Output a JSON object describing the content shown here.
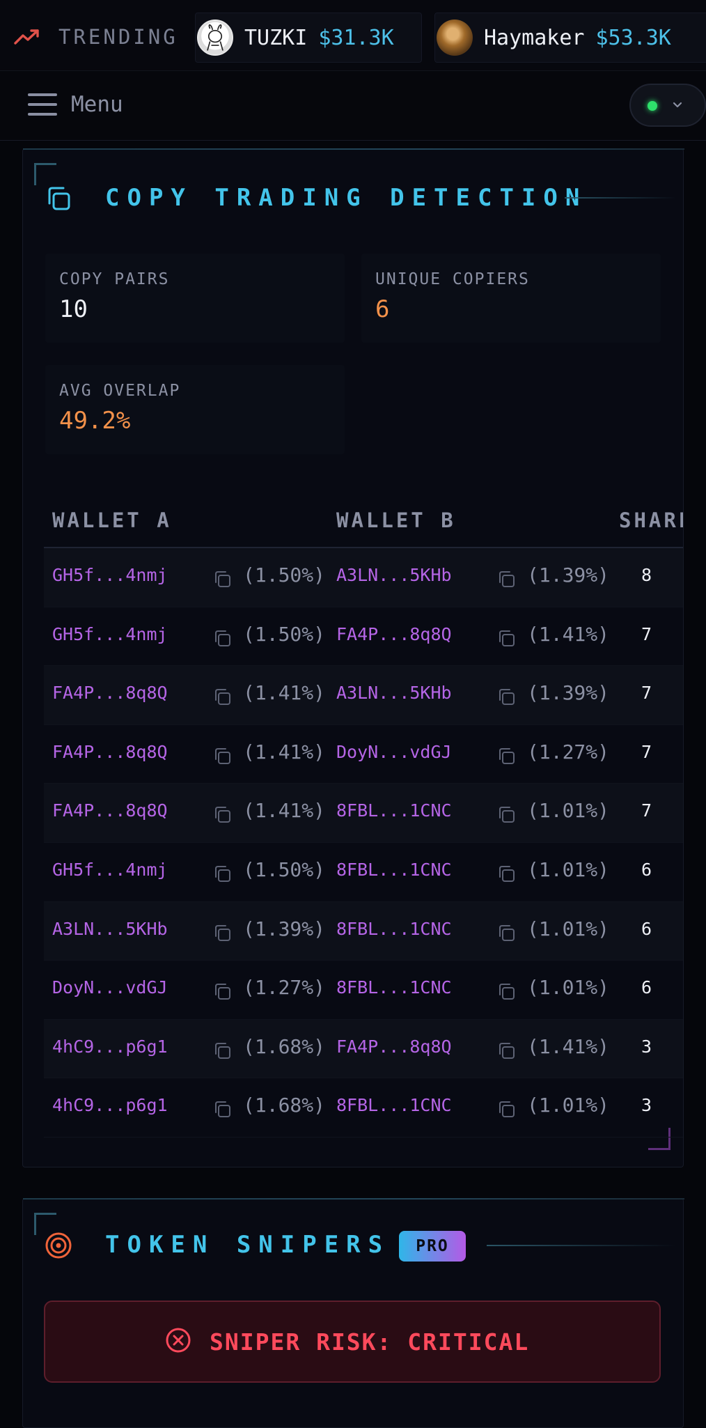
{
  "trending": {
    "label": "TRENDING",
    "tokens": [
      {
        "name": "TUZKI",
        "price": "$31.3K"
      },
      {
        "name": "Haymaker",
        "price": "$53.3K"
      }
    ]
  },
  "menu": {
    "label": "Menu",
    "status_color": "#2ee06b"
  },
  "copy_trading": {
    "title": "COPY TRADING DETECTION",
    "stats": [
      {
        "label": "COPY PAIRS",
        "value": "10"
      },
      {
        "label": "UNIQUE COPIERS",
        "value": "6"
      },
      {
        "label": "AVG OVERLAP",
        "value": "49.2%"
      }
    ],
    "table": {
      "headers": [
        "WALLET A",
        "WALLET B",
        "SHARED"
      ],
      "rows": [
        {
          "a": "GH5f...4nmj",
          "a_pct": "(1.50%)",
          "b": "A3LN...5KHb",
          "b_pct": "(1.39%)",
          "shared": "8"
        },
        {
          "a": "GH5f...4nmj",
          "a_pct": "(1.50%)",
          "b": "FA4P...8q8Q",
          "b_pct": "(1.41%)",
          "shared": "7"
        },
        {
          "a": "FA4P...8q8Q",
          "a_pct": "(1.41%)",
          "b": "A3LN...5KHb",
          "b_pct": "(1.39%)",
          "shared": "7"
        },
        {
          "a": "FA4P...8q8Q",
          "a_pct": "(1.41%)",
          "b": "DoyN...vdGJ",
          "b_pct": "(1.27%)",
          "shared": "7"
        },
        {
          "a": "FA4P...8q8Q",
          "a_pct": "(1.41%)",
          "b": "8FBL...1CNC",
          "b_pct": "(1.01%)",
          "shared": "7"
        },
        {
          "a": "GH5f...4nmj",
          "a_pct": "(1.50%)",
          "b": "8FBL...1CNC",
          "b_pct": "(1.01%)",
          "shared": "6"
        },
        {
          "a": "A3LN...5KHb",
          "a_pct": "(1.39%)",
          "b": "8FBL...1CNC",
          "b_pct": "(1.01%)",
          "shared": "6"
        },
        {
          "a": "DoyN...vdGJ",
          "a_pct": "(1.27%)",
          "b": "8FBL...1CNC",
          "b_pct": "(1.01%)",
          "shared": "6"
        },
        {
          "a": "4hC9...p6g1",
          "a_pct": "(1.68%)",
          "b": "FA4P...8q8Q",
          "b_pct": "(1.41%)",
          "shared": "3"
        },
        {
          "a": "4hC9...p6g1",
          "a_pct": "(1.68%)",
          "b": "8FBL...1CNC",
          "b_pct": "(1.01%)",
          "shared": "3"
        }
      ]
    }
  },
  "token_snipers": {
    "title": "TOKEN SNIPERS",
    "badge": "PRO",
    "risk_text": "SNIPER RISK: CRITICAL"
  },
  "colors": {
    "accent_cyan": "#43c4ea",
    "wallet_purple": "#b565e6",
    "value_orange": "#f3914a",
    "danger_red": "#ff4a5c"
  }
}
